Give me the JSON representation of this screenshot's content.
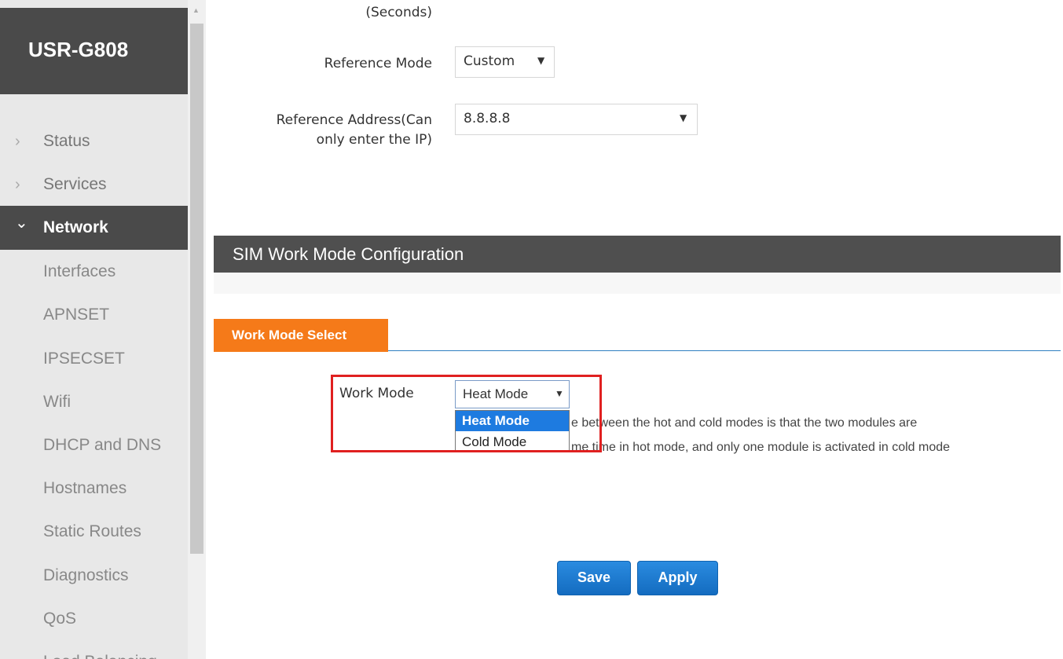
{
  "sidebar": {
    "brand": "USR-G808",
    "nav": [
      {
        "label": "Status",
        "chevron": "›"
      },
      {
        "label": "Services",
        "chevron": "›"
      },
      {
        "label": "Network",
        "chevron": "⌄"
      }
    ],
    "sub_items": [
      "Interfaces",
      "APNSET",
      "IPSECSET",
      "Wifi",
      "DHCP and DNS",
      "Hostnames",
      "Static Routes",
      "Diagnostics",
      "QoS",
      "Load Balancing"
    ]
  },
  "form": {
    "seconds_label": "(Seconds)",
    "reference_mode_label": "Reference Mode",
    "reference_mode_value": "Custom",
    "reference_address_label_line1": "Reference Address(Can",
    "reference_address_label_line2": "only enter the IP)",
    "reference_address_value": "8.8.8.8"
  },
  "section": {
    "title": "SIM Work Mode Configuration",
    "tab": "Work Mode Select",
    "work_mode_label": "Work Mode",
    "work_mode_value": "Heat Mode",
    "options": [
      "Heat Mode",
      "Cold Mode"
    ],
    "desc_line1": "e between the hot and cold modes is that the two modules are",
    "desc_line2": "me time in hot mode, and only one module is activated in cold mode"
  },
  "buttons": {
    "save": "Save",
    "apply": "Apply"
  },
  "colors": {
    "sidebar_active": "#4a4a4a",
    "tab_orange": "#f57a19",
    "button_blue": "#1a7ad0",
    "highlight_red": "#e02020"
  }
}
